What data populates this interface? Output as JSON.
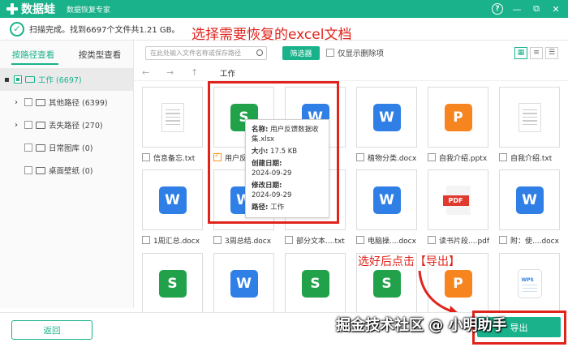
{
  "app": {
    "name": "数据蛙",
    "subtitle": "数据恢复专家",
    "help_glyph": "?",
    "min_glyph": "—",
    "close_glyph": "✕",
    "restore_glyph": "⧉"
  },
  "status": {
    "icon": "check-circle-icon",
    "text": "扫描完成。找到6697个文件共1.21 GB。"
  },
  "annotations": {
    "title": "选择需要恢复的excel文档",
    "export_hint": "选好后点击【导出】",
    "watermark": "掘金技术社区 @ 小明助手"
  },
  "sidebar": {
    "tabs": [
      {
        "label": "按路径查看",
        "active": true
      },
      {
        "label": "按类型查看",
        "active": false
      }
    ],
    "tree": [
      {
        "label": "工作 (6697)"
      },
      {
        "label": "其他路径 (6399)"
      },
      {
        "label": "丢失路径 (270)"
      },
      {
        "label": "日常图库 (0)"
      },
      {
        "label": "桌面壁纸 (0)"
      }
    ]
  },
  "toolbar": {
    "search_placeholder": "在此处输入文件名称或保存路径",
    "filter_label": "筛选器",
    "deleted_only_label": "仅显示删除项"
  },
  "nav": {
    "back": "←",
    "forward": "→",
    "up": "↑",
    "breadcrumb": "工作"
  },
  "files": [
    {
      "name": "信息备忘.txt",
      "type": "txt",
      "checked": false
    },
    {
      "name": "用户反...xlsx",
      "type": "xls",
      "checked": true
    },
    {
      "name": "....docx",
      "type": "doc",
      "checked": false
    },
    {
      "name": "植物分类.docx",
      "type": "doc",
      "checked": false
    },
    {
      "name": "自我介绍.pptx",
      "type": "ppt",
      "checked": false
    },
    {
      "name": "自我介绍.txt",
      "type": "txt",
      "checked": false
    },
    {
      "name": "1周汇总.docx",
      "type": "doc",
      "checked": false
    },
    {
      "name": "3周总结.docx",
      "type": "doc",
      "checked": false
    },
    {
      "name": "部分文本....txt",
      "type": "txt",
      "checked": false
    },
    {
      "name": "电脑操....docx",
      "type": "doc",
      "checked": false
    },
    {
      "name": "读书片段....pdf",
      "type": "pdf",
      "checked": false
    },
    {
      "name": "附：使....docx",
      "type": "doc",
      "checked": false
    },
    {
      "name": "",
      "type": "xls",
      "checked": false
    },
    {
      "name": "",
      "type": "doc",
      "checked": false
    },
    {
      "name": "",
      "type": "xls",
      "checked": false
    },
    {
      "name": "",
      "type": "xls",
      "checked": false
    },
    {
      "name": "",
      "type": "ppt",
      "checked": false
    },
    {
      "name": "",
      "type": "wps",
      "checked": false
    }
  ],
  "icon_letters": {
    "xls": "S",
    "doc": "W",
    "ppt": "P",
    "pdf": "PDF",
    "wps": "WPS"
  },
  "tooltip": {
    "name_key": "名称:",
    "name_val": "用户反馈数据收集.xlsx",
    "size_key": "大小:",
    "size_val": "17.5 KB",
    "created_key": "创建日期:",
    "created_val": "2024-09-29",
    "modified_key": "修改日期:",
    "modified_val": "2024-09-29",
    "path_key": "路径:",
    "path_val": "工作"
  },
  "bottom": {
    "back_label": "返回",
    "export_label": "导出"
  },
  "colors": {
    "brand": "#19b28a",
    "annotation_red": "#e0241c",
    "checked_orange": "#f29a1b"
  }
}
